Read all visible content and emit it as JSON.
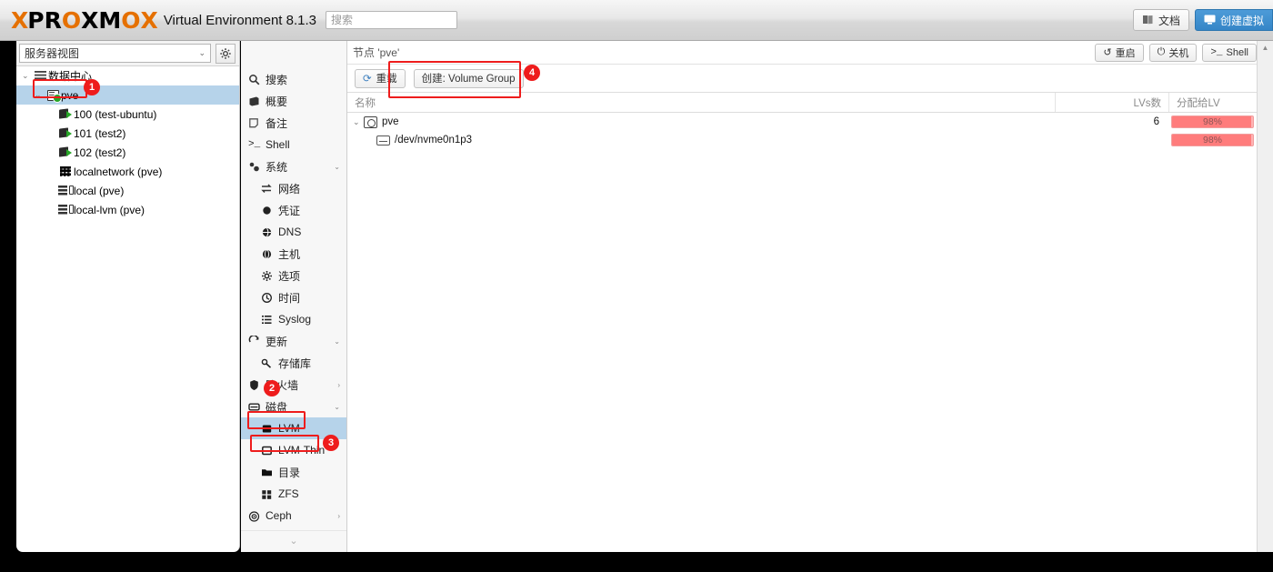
{
  "header": {
    "logo_x": "X",
    "logo_word_1": "PR",
    "logo_word_o": "O",
    "logo_word_2": "XM",
    "logo_word_o2": "O",
    "logo_x2": "X",
    "product": "Virtual Environment 8.1.3",
    "search_placeholder": "搜索",
    "docs_label": "文档",
    "docs_icon": "book-icon",
    "create_vm_label": "创建虚拟",
    "create_vm_icon": "monitor-icon"
  },
  "sidebar": {
    "view_selector": "服务器视图",
    "view_caret": "⌄",
    "gear_icon": "gear-icon",
    "tree": [
      {
        "label": "数据中心",
        "icon": "datacenter-icon",
        "indent": 0,
        "twisty": "⌄",
        "selected": false
      },
      {
        "label": "pve",
        "icon": "node-icon",
        "indent": 1,
        "twisty": "⌄",
        "selected": true
      },
      {
        "label": "100 (test-ubuntu)",
        "icon": "vm-icon",
        "indent": 2,
        "twisty": "",
        "selected": false
      },
      {
        "label": "101 (test2)",
        "icon": "vm-icon",
        "indent": 2,
        "twisty": "",
        "selected": false
      },
      {
        "label": "102 (test2)",
        "icon": "vm-icon",
        "indent": 2,
        "twisty": "",
        "selected": false
      },
      {
        "label": "localnetwork (pve)",
        "icon": "network-icon",
        "indent": 2,
        "twisty": "",
        "selected": false
      },
      {
        "label": "local (pve)",
        "icon": "storage-icon",
        "indent": 2,
        "twisty": "",
        "selected": false
      },
      {
        "label": "local-lvm (pve)",
        "icon": "storage-icon",
        "indent": 2,
        "twisty": "",
        "selected": false
      }
    ]
  },
  "nav": {
    "items": [
      {
        "label": "搜索",
        "icon": "search-icon",
        "sub": false,
        "caret": "",
        "selected": false
      },
      {
        "label": "概要",
        "icon": "summary-icon",
        "sub": false,
        "caret": "",
        "selected": false
      },
      {
        "label": "备注",
        "icon": "notes-icon",
        "sub": false,
        "caret": "",
        "selected": false
      },
      {
        "label": "Shell",
        "icon": "shell-icon",
        "sub": false,
        "caret": "",
        "selected": false
      },
      {
        "label": "系统",
        "icon": "system-icon",
        "sub": false,
        "caret": "⌄",
        "selected": false
      },
      {
        "label": "网络",
        "icon": "network-icon",
        "sub": true,
        "caret": "",
        "selected": false
      },
      {
        "label": "凭证",
        "icon": "certificate-icon",
        "sub": true,
        "caret": "",
        "selected": false
      },
      {
        "label": "DNS",
        "icon": "dns-icon",
        "sub": true,
        "caret": "",
        "selected": false
      },
      {
        "label": "主机",
        "icon": "hosts-icon",
        "sub": true,
        "caret": "",
        "selected": false
      },
      {
        "label": "选项",
        "icon": "options-icon",
        "sub": true,
        "caret": "",
        "selected": false
      },
      {
        "label": "时间",
        "icon": "time-icon",
        "sub": true,
        "caret": "",
        "selected": false
      },
      {
        "label": "Syslog",
        "icon": "syslog-icon",
        "sub": true,
        "caret": "",
        "selected": false
      },
      {
        "label": "更新",
        "icon": "update-icon",
        "sub": false,
        "caret": "⌄",
        "selected": false
      },
      {
        "label": "存储库",
        "icon": "repository-icon",
        "sub": true,
        "caret": "",
        "selected": false
      },
      {
        "label": "防火墙",
        "icon": "firewall-icon",
        "sub": false,
        "caret": "›",
        "selected": false
      },
      {
        "label": "磁盘",
        "icon": "disk-icon",
        "sub": false,
        "caret": "⌄",
        "selected": false
      },
      {
        "label": "LVM",
        "icon": "lvm-icon",
        "sub": true,
        "caret": "",
        "selected": true
      },
      {
        "label": "LVM-Thin",
        "icon": "lvmthin-icon",
        "sub": true,
        "caret": "",
        "selected": false
      },
      {
        "label": "目录",
        "icon": "directory-icon",
        "sub": true,
        "caret": "",
        "selected": false
      },
      {
        "label": "ZFS",
        "icon": "zfs-icon",
        "sub": true,
        "caret": "",
        "selected": false
      },
      {
        "label": "Ceph",
        "icon": "ceph-icon",
        "sub": false,
        "caret": "›",
        "selected": false
      }
    ],
    "scroll_down_icon": "chevron-down-icon"
  },
  "main": {
    "node_title": "节点 'pve'",
    "restart_label": "重启",
    "restart_icon": "restart-icon",
    "shutdown_label": "关机",
    "shutdown_icon": "power-icon",
    "shell_label": "Shell",
    "shell_icon": "shell-icon",
    "reload_label": "重载",
    "reload_icon": "reload-icon",
    "create_vg_label": "创建: Volume Group",
    "columns": {
      "name": "名称",
      "lvs": "LVs数",
      "alloc": "分配给LV"
    },
    "rows": [
      {
        "name": "pve",
        "icon": "volume-group-icon",
        "twisty": "⌄",
        "indent": 0,
        "lvs": "6",
        "alloc_pct": "98%",
        "alloc_value": 98
      },
      {
        "name": "/dev/nvme0n1p3",
        "icon": "disk-icon",
        "twisty": "",
        "indent": 1,
        "lvs": "",
        "alloc_pct": "98%",
        "alloc_value": 98
      }
    ]
  },
  "annotations": {
    "badges": [
      {
        "number": "1"
      },
      {
        "number": "2"
      },
      {
        "number": "3"
      },
      {
        "number": "4"
      }
    ],
    "color": "#ee1c1c"
  }
}
